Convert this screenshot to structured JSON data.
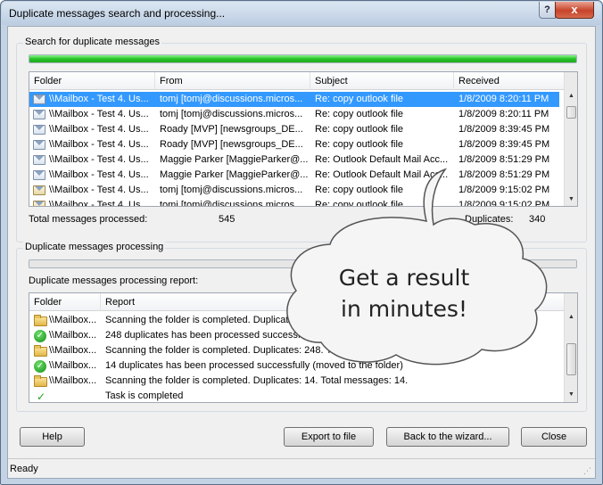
{
  "window": {
    "title": "Duplicate messages search and processing...",
    "help_glyph": "?",
    "close_glyph": "x"
  },
  "search": {
    "group_label": "Search for duplicate messages",
    "progress_fraction": 1.0,
    "columns": [
      "Folder",
      "From",
      "Subject",
      "Received"
    ],
    "rows": [
      {
        "icon": "mail-icon",
        "folder": "\\\\Mailbox - Test 4. Us...",
        "from": "tomj [tomj@discussions.micros...",
        "subject": "Re: copy outlook file",
        "received": "1/8/2009 8:20:11 PM",
        "selected": true,
        "struck": false
      },
      {
        "icon": "mail-icon",
        "folder": "\\\\Mailbox - Test 4. Us...",
        "from": "tomj [tomj@discussions.micros...",
        "subject": "Re: copy outlook file",
        "received": "1/8/2009 8:20:11 PM",
        "selected": false,
        "struck": true
      },
      {
        "icon": "mail-icon",
        "folder": "\\\\Mailbox - Test 4. Us...",
        "from": "Roady [MVP] [newsgroups_DE...",
        "subject": "Re: copy outlook file",
        "received": "1/8/2009 8:39:45 PM",
        "selected": false,
        "struck": false
      },
      {
        "icon": "mail-icon",
        "folder": "\\\\Mailbox - Test 4. Us...",
        "from": "Roady [MVP] [newsgroups_DE...",
        "subject": "Re: copy outlook file",
        "received": "1/8/2009 8:39:45 PM",
        "selected": false,
        "struck": true
      },
      {
        "icon": "mail-icon",
        "folder": "\\\\Mailbox - Test 4. Us...",
        "from": "Maggie Parker [MaggieParker@...",
        "subject": "Re: Outlook Default Mail Acc...",
        "received": "1/8/2009 8:51:29 PM",
        "selected": false,
        "struck": false
      },
      {
        "icon": "mail-icon",
        "folder": "\\\\Mailbox - Test 4. Us...",
        "from": "Maggie Parker [MaggieParker@...",
        "subject": "Re: Outlook Default Mail Acc...",
        "received": "1/8/2009 8:51:29 PM",
        "selected": false,
        "struck": true
      },
      {
        "icon": "opened-mail-icon",
        "folder": "\\\\Mailbox - Test 4. Us...",
        "from": "tomj [tomj@discussions.micros...",
        "subject": "Re: copy outlook file",
        "received": "1/8/2009 9:15:02 PM",
        "selected": false,
        "struck": false
      },
      {
        "icon": "opened-mail-icon",
        "folder": "\\\\Mailbox - Test 4. Us...",
        "from": "tomj [tomj@discussions.micros...",
        "subject": "Re: copy outlook file",
        "received": "1/8/2009 9:15:02 PM",
        "selected": false,
        "struck": true
      }
    ],
    "total_label": "Total messages processed:",
    "total_value": "545",
    "duplicates_label": "Duplicates:",
    "duplicates_value": "340"
  },
  "processing": {
    "group_label": "Duplicate messages processing",
    "progress_fraction": 0.0,
    "report_label": "Duplicate messages processing report:",
    "columns": [
      "Folder",
      "Report"
    ],
    "rows": [
      {
        "icon": "folder-icon",
        "folder": "\\\\Mailbox...",
        "report": "Scanning the folder is completed. Duplicates: 248. Total messages: 248."
      },
      {
        "icon": "check-circle-icon",
        "folder": "\\\\Mailbox...",
        "report": "248 duplicates has been processed successfully (moved to the folder)"
      },
      {
        "icon": "folder-icon",
        "folder": "\\\\Mailbox...",
        "report": "Scanning the folder is completed. Duplicates: 248. Total messages: 248."
      },
      {
        "icon": "check-circle-icon",
        "folder": "\\\\Mailbox...",
        "report": "14 duplicates has been processed successfully (moved to the folder)"
      },
      {
        "icon": "folder-icon",
        "folder": "\\\\Mailbox...",
        "report": "Scanning the folder is completed. Duplicates: 14. Total messages: 14."
      },
      {
        "icon": "check-mark-icon",
        "folder": "",
        "report": "Task is completed"
      }
    ]
  },
  "buttons": {
    "help": "Help",
    "export": "Export to file",
    "back": "Back to the wizard...",
    "close": "Close"
  },
  "status": {
    "text": "Ready"
  },
  "callout": {
    "line1": "Get a result",
    "line2": "in minutes!"
  }
}
